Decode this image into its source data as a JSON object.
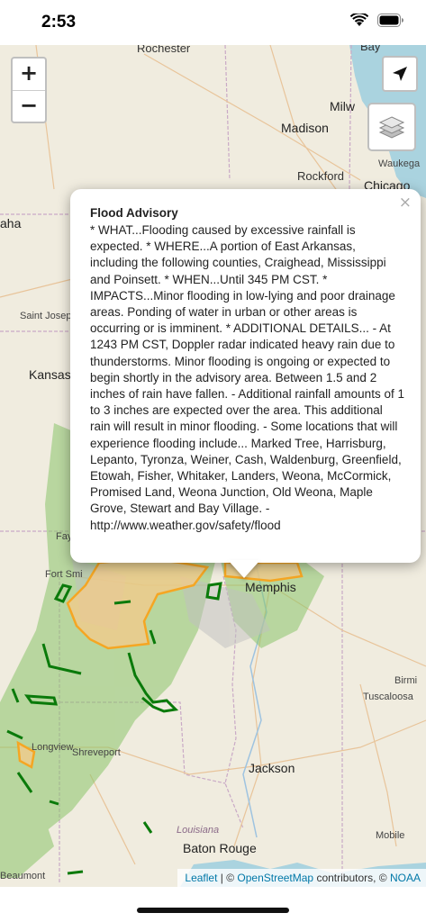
{
  "status_bar": {
    "time": "2:53",
    "icons": [
      "signal-icon",
      "wifi-icon",
      "battery-icon"
    ]
  },
  "map": {
    "labels": {
      "rochester": "Rochester",
      "milw": "Milw",
      "bay": "Bay",
      "madison": "Madison",
      "waukega": "Waukega",
      "rockford": "Rockford",
      "chicago": "Chicago",
      "aha": "aha",
      "saint_joseph": "Saint Josep",
      "kansas": "Kansas",
      "fay": "Fay",
      "fort_smith": "Fort Smi",
      "memphis": "Memphis",
      "birmi": "Birmi",
      "tuscaloosa": "Tuscaloosa",
      "longview": "Longview",
      "shreveport": "Shreveport",
      "jackson": "Jackson",
      "louisiana": "Louisiana",
      "baton_rouge": "Baton Rouge",
      "mobile": "Mobile",
      "beaumont": "Beaumont"
    },
    "zoom_in_label": "+",
    "zoom_out_label": "−",
    "colors": {
      "land": "#f0ecdf",
      "water": "#aad3df",
      "radar_green": "#8bc56a",
      "advisory_orange": "#f5a623",
      "warning_green": "#0a7a0a"
    }
  },
  "popup": {
    "title": "Flood Advisory",
    "body": "* WHAT...Flooding caused by excessive rainfall is expected. * WHERE...A portion of East Arkansas, including the following counties, Craighead, Mississippi and Poinsett. * WHEN...Until 345 PM CST. * IMPACTS...Minor flooding in low-lying and poor drainage areas. Ponding of water in urban or other areas is occurring or is imminent. * ADDITIONAL DETAILS... - At 1243 PM CST, Doppler radar indicated heavy rain due to thunderstorms. Minor flooding is ongoing or expected to begin shortly in the advisory area. Between 1.5 and 2 inches of rain have fallen. - Additional rainfall amounts of 1 to 3 inches are expected over the area. This additional rain will result in minor flooding. - Some locations that will experience flooding include... Marked Tree, Harrisburg, Lepanto, Tyronza, Weiner, Cash, Waldenburg, Greenfield, Etowah, Fisher, Whitaker, Landers, Weona, McCormick, Promised Land, Weona Junction, Old Weona, Maple Grove, Stewart and Bay Village. - http://www.weather.gov/safety/flood",
    "close_label": "×"
  },
  "attribution": {
    "leaflet": "Leaflet",
    "sep1": " | © ",
    "osm": "OpenStreetMap",
    "contributors": " contributors, © ",
    "noaa": "NOAA"
  }
}
